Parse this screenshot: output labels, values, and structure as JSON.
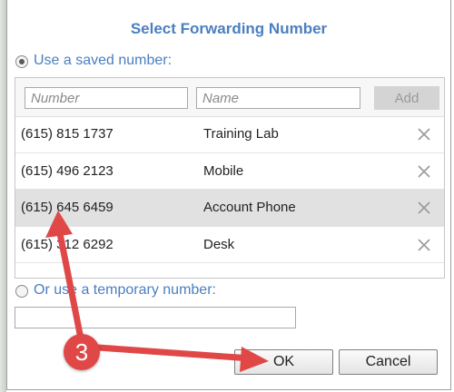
{
  "dialog": {
    "title": "Select Forwarding Number",
    "saved_option_label": "Use a saved number:",
    "temporary_option_label": "Or use a temporary number:",
    "number_placeholder": "Number",
    "name_placeholder": "Name",
    "add_label": "Add",
    "ok_label": "OK",
    "cancel_label": "Cancel",
    "saved_numbers": [
      {
        "number": "(615) 815 1737",
        "name": "Training Lab"
      },
      {
        "number": "(615) 496 2123",
        "name": "Mobile"
      },
      {
        "number": "(615) 645 6459",
        "name": "Account Phone"
      },
      {
        "number": "(615) 312 6292",
        "name": "Desk"
      }
    ],
    "selected_row": 2
  },
  "annotation": {
    "step_number": "3",
    "accent_color": "#e04848"
  }
}
